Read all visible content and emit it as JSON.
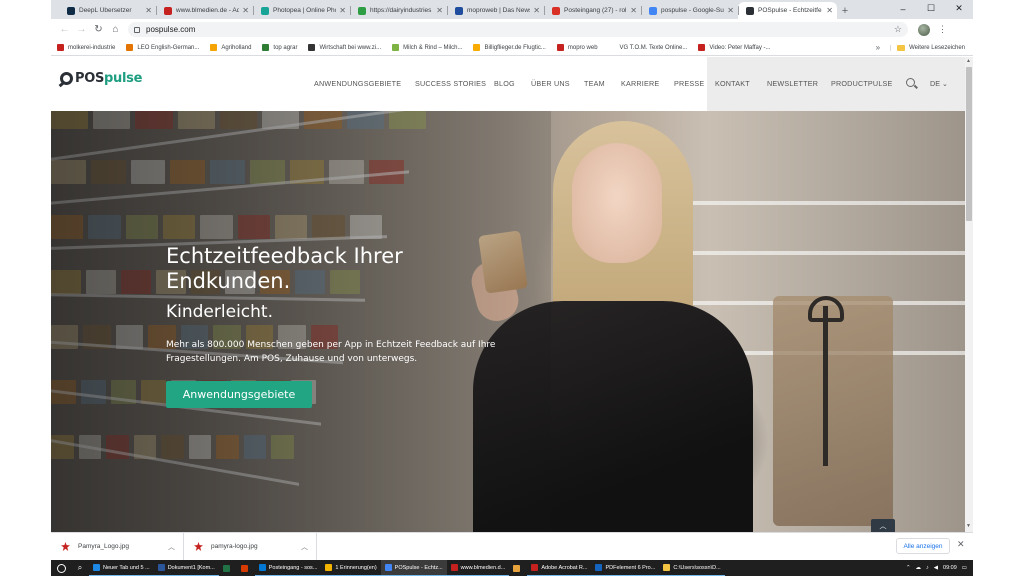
{
  "browser": {
    "tabs": [
      {
        "title": "DeepL Übersetzer",
        "color": "#0f2b46",
        "active": false
      },
      {
        "title": "www.blmedien.de - Ad",
        "color": "#c5221f",
        "active": false
      },
      {
        "title": "Photopea | Online Pho",
        "color": "#18a497",
        "active": false
      },
      {
        "title": "https://dairyindustries",
        "color": "#2e9e44",
        "active": false
      },
      {
        "title": "moproweb | Das News",
        "color": "#1f4e9e",
        "active": false
      },
      {
        "title": "Posteingang (27) - rol",
        "color": "#d93025",
        "active": false
      },
      {
        "title": "pospulse - Google-Su",
        "color": "#4285f4",
        "active": false
      },
      {
        "title": "POSpulse - Echtzeitfe",
        "color": "#2b2f36",
        "active": true
      }
    ],
    "new_tab": "+",
    "window_controls": {
      "minimize": "–",
      "maximize": "☐",
      "close": "✕"
    },
    "url": "pospulse.com",
    "bookmarks": [
      {
        "label": "molkerei-industrie",
        "color": "#c5221f"
      },
      {
        "label": "LEO English-German...",
        "color": "#e37400"
      },
      {
        "label": "Agriholland",
        "color": "#f4a300"
      },
      {
        "label": "top agrar",
        "color": "#2e7d32"
      },
      {
        "label": "Wirtschaft bei www.zi...",
        "color": "#333333"
      },
      {
        "label": "Milch & Rind – Milch...",
        "color": "#7cb342"
      },
      {
        "label": "Billigflieger.de Flugtic...",
        "color": "#f9ab00"
      },
      {
        "label": "mopro web",
        "color": "#c5221f"
      },
      {
        "label": "VG  T.O.M. Texte Online...",
        "color": "#ffffff"
      },
      {
        "label": "Video: Peter Maffay -...",
        "color": "#c5221f"
      }
    ],
    "bookmarks_more": "»",
    "other_bookmarks": "Weitere Lesezeichen"
  },
  "site": {
    "logo_pos": "POS",
    "logo_pulse": "pulse",
    "nav": [
      {
        "label": "ANWENDUNGSGEBIETE"
      },
      {
        "label": "SUCCESS STORIES"
      },
      {
        "label": "BLOG"
      },
      {
        "label": "ÜBER UNS"
      },
      {
        "label": "TEAM"
      },
      {
        "label": "KARRIERE"
      },
      {
        "label": "PRESSE"
      },
      {
        "label": "KONTAKT"
      },
      {
        "label": "NEWSLETTER"
      },
      {
        "label": "PRODUCTPULSE"
      }
    ],
    "lang": "DE ⌄",
    "hero": {
      "title": "Echtzeitfeedback Ihrer Endkunden.",
      "subtitle": "Kinderleicht.",
      "text": "Mehr als 800.000 Menschen geben per App in Echtzeit Feedback auf Ihre Fragestellungen. Am POS, Zuhause und von unterwegs.",
      "cta": "Anwendungsgebiete",
      "accent": "#21a582"
    },
    "scroll_top": "︿"
  },
  "downloads": {
    "items": [
      {
        "name": "Pamyra_Logo.jpg"
      },
      {
        "name": "pamyra-logo.jpg"
      }
    ],
    "show_all": "Alle anzeigen",
    "close": "✕"
  },
  "taskbar": {
    "apps": [
      {
        "label": "Neuer Tab und 5 ...",
        "color": "#1e88e5"
      },
      {
        "label": "Dokument1 [Kom...",
        "color": "#2b579a"
      },
      {
        "label": "",
        "color": "#217346"
      },
      {
        "label": "",
        "color": "#d83b01"
      },
      {
        "label": "Posteingang - sos...",
        "color": "#0078d4"
      },
      {
        "label": "1 Erinnerung(en)",
        "color": "#f4b400"
      },
      {
        "label": "POSpulse - Echtz...",
        "color": "#4285f4"
      },
      {
        "label": "www.blmedien.d...",
        "color": "#c5221f"
      },
      {
        "label": "",
        "color": "#e8a33c"
      },
      {
        "label": "Adobe Acrobat R...",
        "color": "#c5221f"
      },
      {
        "label": "PDFelement 6 Pro...",
        "color": "#1565c0"
      },
      {
        "label": "C:\\Users\\sossn\\D...",
        "color": "#f4c542"
      }
    ],
    "time": "09:09"
  }
}
